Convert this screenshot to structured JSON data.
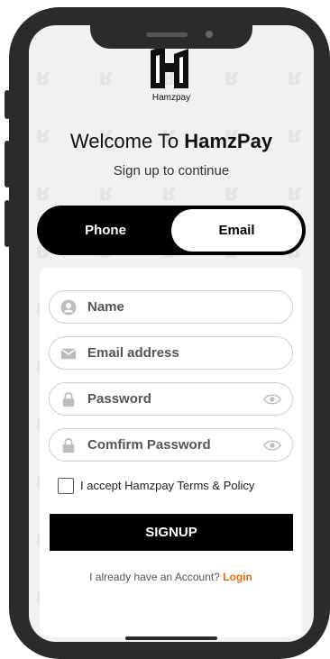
{
  "header": {
    "logo_text": "Hamzpay",
    "welcome_prefix": "Welcome To ",
    "welcome_brand": "HamzPay",
    "subtitle": "Sign up to continue"
  },
  "tabs": [
    {
      "label": "Phone",
      "selected": false
    },
    {
      "label": "Email",
      "selected": true
    }
  ],
  "form": {
    "name_placeholder": "Name",
    "email_placeholder": "Email address",
    "password_placeholder": "Password",
    "confirm_placeholder": "Comfirm Password",
    "terms_label": "I accept Hamzpay Terms & Policy",
    "terms_checked": false,
    "signup_label": "SIGNUP"
  },
  "footer": {
    "login_prompt": "I already have an Account? ",
    "login_link": "Login"
  },
  "icons": {
    "name": "user-icon",
    "email": "envelope-icon",
    "password": "lock-icon",
    "visibility": "eye-icon"
  },
  "colors": {
    "accent": "#e8690f",
    "primary": "#000000",
    "background": "#f1f1f1"
  }
}
